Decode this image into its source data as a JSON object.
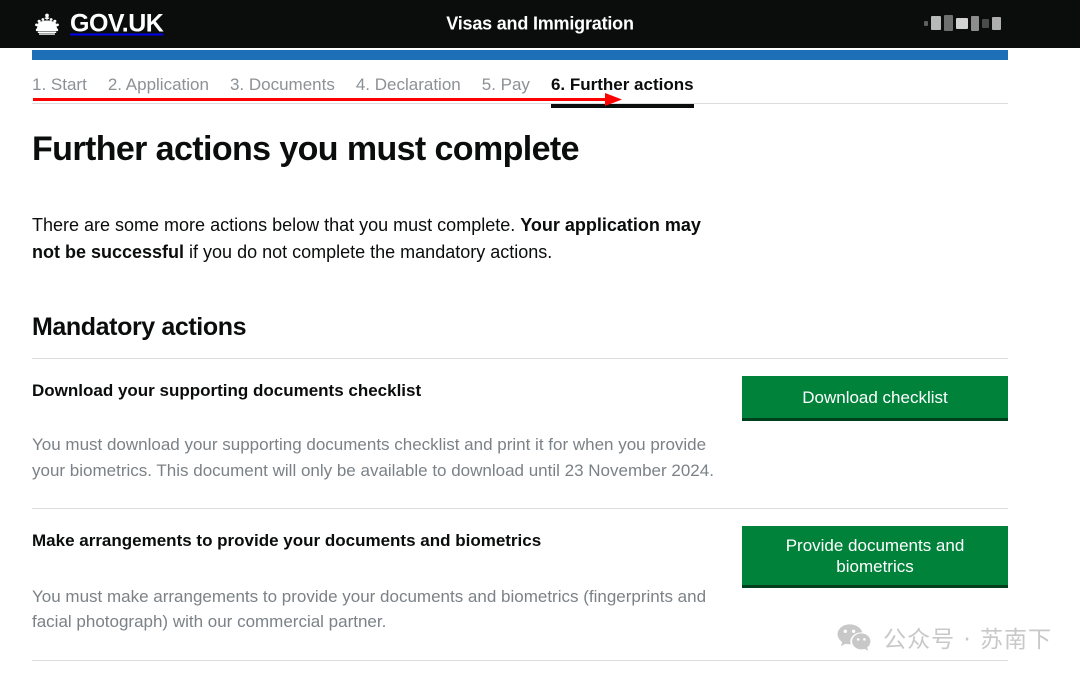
{
  "header": {
    "brand": "GOV.UK",
    "crown_icon": "crown-icon",
    "service_name": "Visas and Immigration",
    "redacted_region": "redacted-account-name"
  },
  "step_nav": {
    "steps": [
      {
        "label": "1. Start",
        "active": false
      },
      {
        "label": "2. Application",
        "active": false
      },
      {
        "label": "3. Documents",
        "active": false
      },
      {
        "label": "4. Declaration",
        "active": false
      },
      {
        "label": "5. Pay",
        "active": false
      },
      {
        "label": "6. Further actions",
        "active": true
      }
    ],
    "annotation": {
      "type": "arrow",
      "color": "#ff0000",
      "points_to": "6. Further actions"
    }
  },
  "main": {
    "page_title": "Further actions you must complete",
    "intro": {
      "before_bold": "There are some more actions below that you must complete. ",
      "bold": "Your application may not be successful",
      "after_bold": " if you do not complete the mandatory actions."
    },
    "section_title": "Mandatory actions",
    "actions": [
      {
        "heading": "Download your supporting documents checklist",
        "description": "You must download your supporting documents checklist and print it for when you provide your biometrics. This document will only be available to download until 23 November 2024.",
        "button_label": "Download checklist"
      },
      {
        "heading": "Make arrangements to provide your documents and biometrics",
        "description": "You must make arrangements to provide your documents and biometrics (fingerprints and facial photograph) with our commercial partner.",
        "button_label": "Provide documents and biometrics"
      }
    ]
  },
  "watermark": {
    "icon": "wechat-icon",
    "text": "公众号 · 苏南下"
  },
  "colors": {
    "header_background": "#0b0c0c",
    "blue_bar": "#1d70b8",
    "button_green": "#00823b",
    "button_green_shadow": "#00401d",
    "annotation_red": "#ff0000",
    "muted_text": "#7b8287",
    "step_inactive": "#8c9196"
  }
}
